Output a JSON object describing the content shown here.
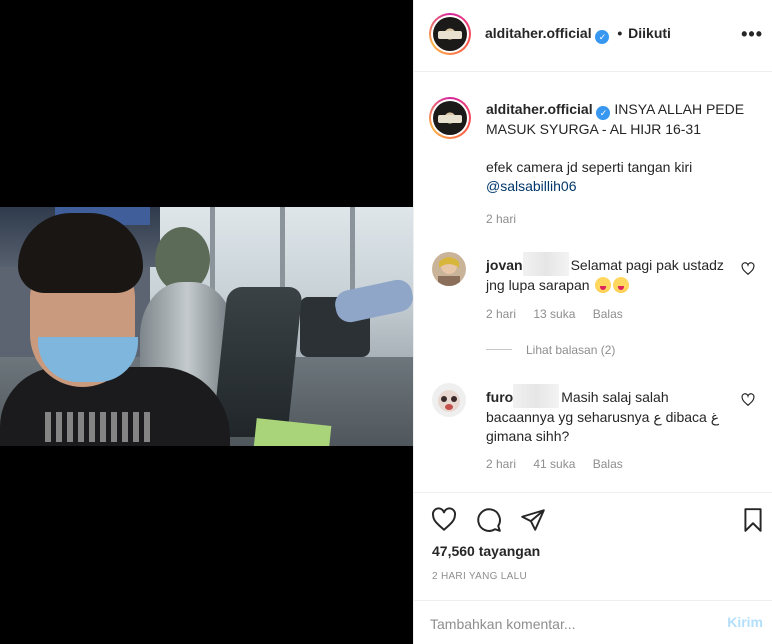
{
  "header": {
    "username": "alditaher.official",
    "separator": "•",
    "follow_status": "Diikuti",
    "more_label": "•••"
  },
  "caption": {
    "username": "alditaher.official",
    "text": "INSYA ALLAH PEDE MASUK SYURGA - AL HIJR 16-31",
    "line2": "efek camera jd seperti tangan kiri",
    "mention": "@salsabillih06",
    "time": "2 hari"
  },
  "comments": [
    {
      "username": "jovan",
      "text": "Selamat pagi pak ustadz jng lupa sarapan",
      "time": "2 hari",
      "likes": "13 suka",
      "reply": "Balas",
      "view_replies": "Lihat balasan (2)"
    },
    {
      "username": "furo",
      "text": "Masih salaj salah bacaannya yg seharusnya ع dibaca غ gimana sihh?",
      "time": "2 hari",
      "likes": "41 suka",
      "reply": "Balas"
    }
  ],
  "actions": {
    "views": "47,560 tayangan",
    "date": "2 HARI YANG LALU"
  },
  "add_comment": {
    "placeholder": "Tambahkan komentar...",
    "post_label": "Kirim"
  },
  "colors": {
    "verified": "#3897f0",
    "link": "#00376b",
    "post_disabled": "#b2dffc",
    "muted": "#8e8e8e"
  }
}
